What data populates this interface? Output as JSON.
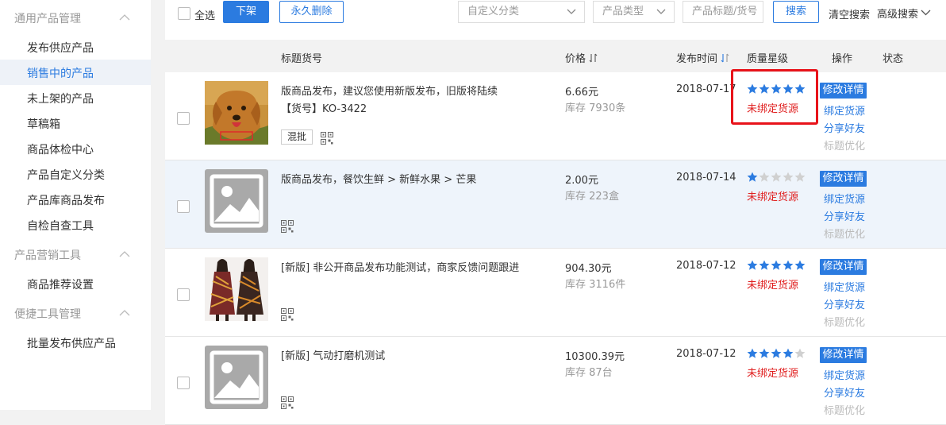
{
  "sidebar": {
    "groups": [
      {
        "title": "通用产品管理",
        "items": [
          "发布供应产品",
          "销售中的产品",
          "未上架的产品",
          "草稿箱",
          "商品体检中心",
          "产品自定义分类",
          "产品库商品发布",
          "自检自查工具"
        ]
      },
      {
        "title": "产品营销工具",
        "items": [
          "商品推荐设置"
        ]
      },
      {
        "title": "便捷工具管理",
        "items": [
          "批量发布供应产品"
        ]
      }
    ],
    "active_item": "销售中的产品"
  },
  "toolbar": {
    "select_all_label": "全选",
    "delist_label": "下架",
    "delete_label": "永久删除",
    "category_placeholder": "自定义分类",
    "type_placeholder": "产品类型",
    "search_placeholder": "产品标题/货号",
    "search_label": "搜索",
    "clear_label": "清空搜索",
    "advanced_label": "高级搜索"
  },
  "table": {
    "headers": {
      "title": "标题货号",
      "price": "价格",
      "date": "发布时间",
      "quality": "质量星级",
      "action": "操作",
      "status": "状态"
    },
    "actions": {
      "edit": "修改详情",
      "bind": "绑定货源",
      "share": "分享好友",
      "optimize": "标题优化"
    },
    "rows": [
      {
        "title": "版商品发布，建议您使用新版发布，旧版将陆续",
        "code": "【货号】KO-3422",
        "tag": "混批",
        "price": "6.66元",
        "stock": "库存 7930条",
        "date": "2018-07-17",
        "stars": 5,
        "source": "未绑定货源",
        "image": "dog"
      },
      {
        "title": "版商品发布，餐饮生鲜 > 新鲜水果 > 芒果",
        "code": "",
        "tag": "",
        "price": "2.00元",
        "stock": "库存 223盒",
        "date": "2018-07-14",
        "stars": 1,
        "source": "未绑定货源",
        "image": "placeholder"
      },
      {
        "title": "[新版] 非公开商品发布功能测试，商家反馈问题跟进",
        "code": "",
        "tag": "",
        "price": "904.30元",
        "stock": "库存 3116件",
        "date": "2018-07-12",
        "stars": 5,
        "source": "未绑定货源",
        "image": "dress"
      },
      {
        "title": "[新版] 气动打磨机测试",
        "code": "",
        "tag": "",
        "price": "10300.39元",
        "stock": "库存 87台",
        "date": "2018-07-12",
        "stars": 4,
        "source": "未绑定货源",
        "image": "placeholder"
      }
    ]
  },
  "colors": {
    "accent": "#2b7be0",
    "warning": "#e02020",
    "highlight_box": "#e8131a"
  }
}
